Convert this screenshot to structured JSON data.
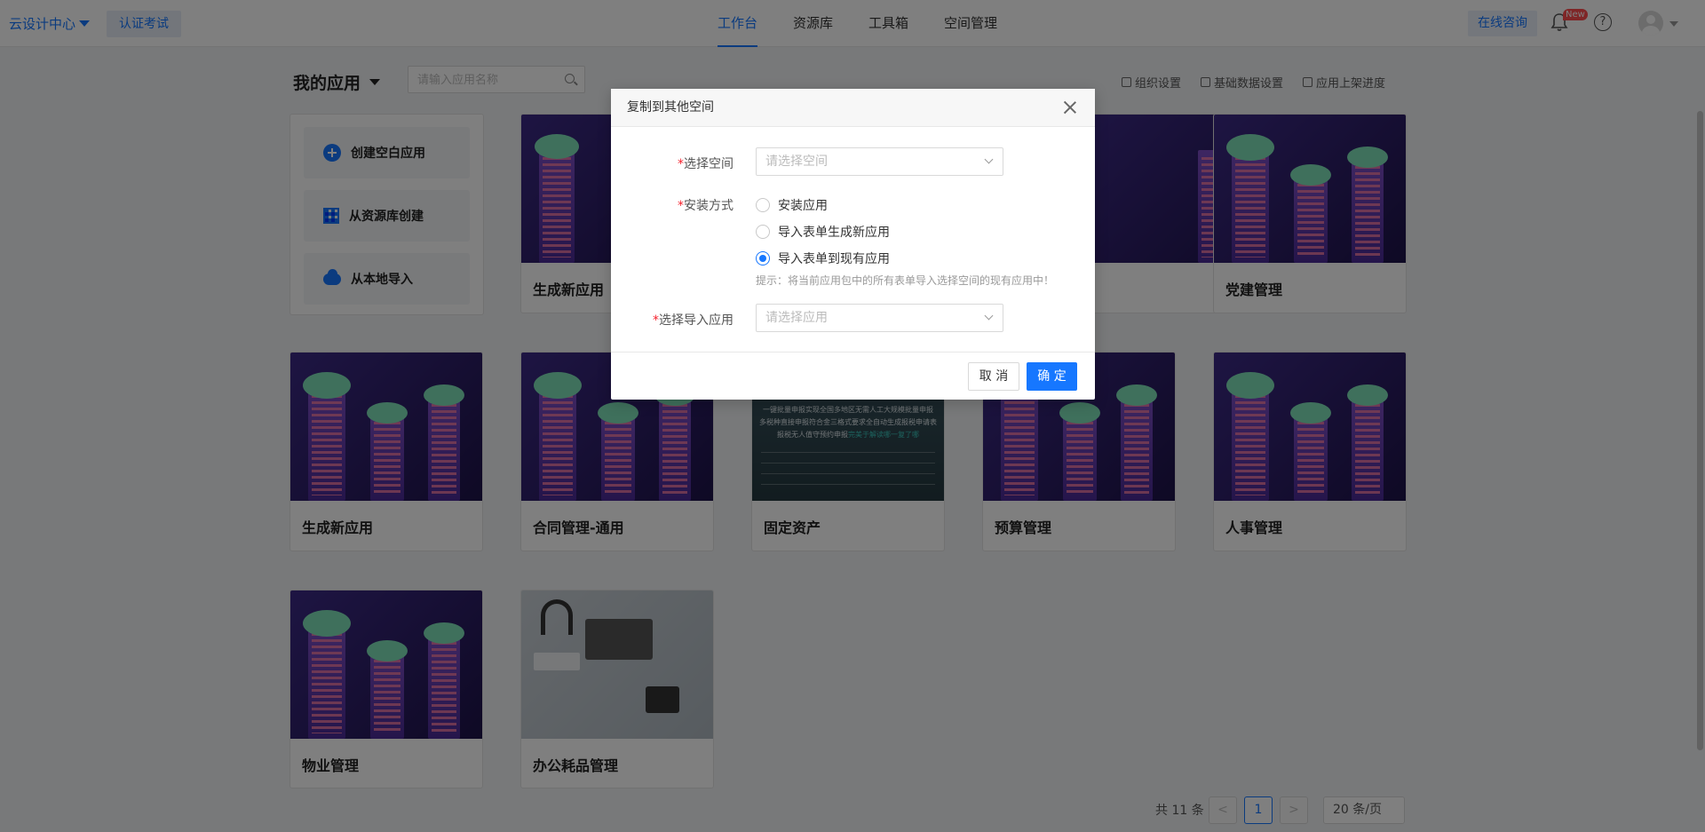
{
  "topbar": {
    "brand": "云设计中心",
    "exam_button": "认证考试",
    "nav_tabs": [
      "工作台",
      "资源库",
      "工具箱",
      "空间管理"
    ],
    "active_tab": "工作台",
    "consult_button": "在线咨询",
    "notification_badge": "New",
    "help_icon": "?"
  },
  "content": {
    "section_title": "我的应用",
    "search_placeholder": "请输入应用名称",
    "top_links": [
      "组织设置",
      "基础数据设置",
      "应用上架进度"
    ],
    "create_items": [
      "创建空白应用",
      "从资源库创建",
      "从本地导入"
    ],
    "apps": [
      "生成新应用",
      "党建管理",
      "生成新应用",
      "合同管理-通用",
      "固定资产",
      "预算管理",
      "人事管理",
      "物业管理",
      "办公耗品管理"
    ],
    "asset_card_text": [
      "一键批量申报实现全国多地区无需人工大规模批量申报",
      "多税种直接申报符合金三格式要求全自动生成报税申请表",
      "报税无人值守预约申报"
    ],
    "asset_card_highlight": "完美于解读哪一复了哪"
  },
  "pagination": {
    "total": "共 11 条",
    "prev": "<",
    "current_page": "1",
    "next": ">",
    "page_size": "20 条/页"
  },
  "modal": {
    "title": "复制到其他空间",
    "space_label": "选择空间",
    "space_placeholder": "请选择空间",
    "install_label": "安装方式",
    "install_options": [
      "安装应用",
      "导入表单生成新应用",
      "导入表单到现有应用"
    ],
    "selected_option": "导入表单到现有应用",
    "hint": "提示：将当前应用包中的所有表单导入选择空间的现有应用中！",
    "import_label": "选择导入应用",
    "import_placeholder": "请选择应用",
    "cancel": "取 消",
    "ok": "确 定"
  },
  "colors": {
    "primary": "#1677ff",
    "required": "#f5222d"
  }
}
